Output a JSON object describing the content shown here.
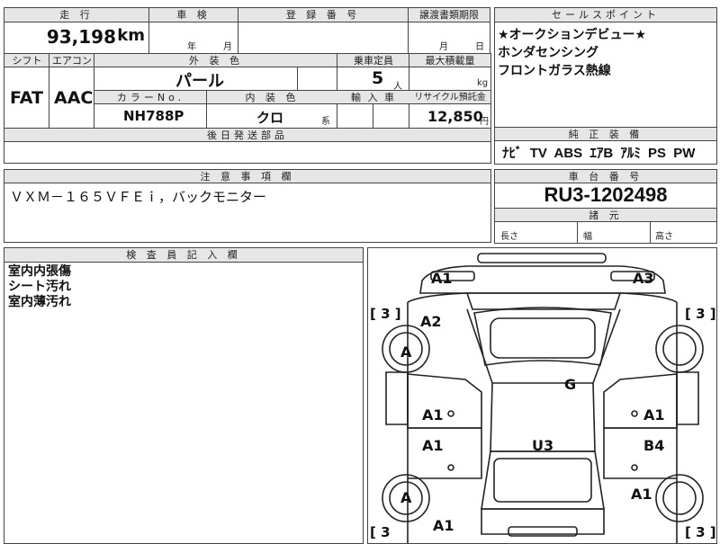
{
  "headers": {
    "mileage": "走 行",
    "inspection": "車 検",
    "registration": "登 録 番 号",
    "transfer_doc": "譲渡書類期限",
    "sales_point": "セールスポイント",
    "shift": "シフト",
    "aircon": "エアコン",
    "exterior_color": "外 装 色",
    "capacity": "乗車定員",
    "max_load": "最大積載量",
    "color_no": "カラーNo.",
    "interior_color": "内 装 色",
    "import": "輸 入 車",
    "recycle": "リサイクル預託金",
    "later_parts": "後日発送部品",
    "genuine_equipment": "純 正 装 備",
    "notes": "注 意 事 項 欄",
    "chassis_no": "車 台 番 号",
    "dimensions": "諸 元",
    "inspector_notes": "検 査 員 記 入 欄"
  },
  "values": {
    "mileage": "93,198",
    "mileage_unit": "km",
    "inspection_year_label": "年",
    "inspection_month_label": "月",
    "transfer_month_label": "月",
    "transfer_day_label": "日",
    "shift": "FAT",
    "aircon": "AAC",
    "exterior_color": "パール",
    "capacity": "5",
    "capacity_unit": "人",
    "load_unit": "kg",
    "color_no": "NH788P",
    "interior_color": "クロ",
    "interior_suffix": "系",
    "recycle": "12,850",
    "recycle_unit": "円",
    "chassis_no": "RU3-1202498",
    "length_label": "長さ",
    "width_label": "幅",
    "height_label": "高さ"
  },
  "sales_points": [
    "★オークションデビュー★",
    "ホンダセンシング",
    "フロントガラス熱線"
  ],
  "equipment": [
    "ﾅﾋﾞ",
    "TV",
    "ABS",
    "ｴｱB",
    "ｱﾙﾐ",
    "PS",
    "PW"
  ],
  "notes_text": "ＶＸＭ－１６５ＶＦＥｉ，バックモニター",
  "inspector_lines": [
    "室内内張傷",
    "シート汚れ",
    "室内薄汚れ"
  ],
  "diagram": {
    "tire_left_top": "[ 3 ]",
    "tire_right_top": "[ 3 ]",
    "tire_left_bottom": "[ 3",
    "tire_right_bottom": "[ 3 ]",
    "marks": {
      "front_left": "A1",
      "front_right": "A3",
      "fender_left_front": "A2",
      "wheel_left_front": "A",
      "roof": "G",
      "door_left_front": "A1",
      "door_right_front": "A1",
      "door_left_rear": "A1",
      "door_right_rear": "B4",
      "center": "U3",
      "wheel_left_rear": "A",
      "fender_right_rear": "A1",
      "rear_left": "A1"
    }
  }
}
